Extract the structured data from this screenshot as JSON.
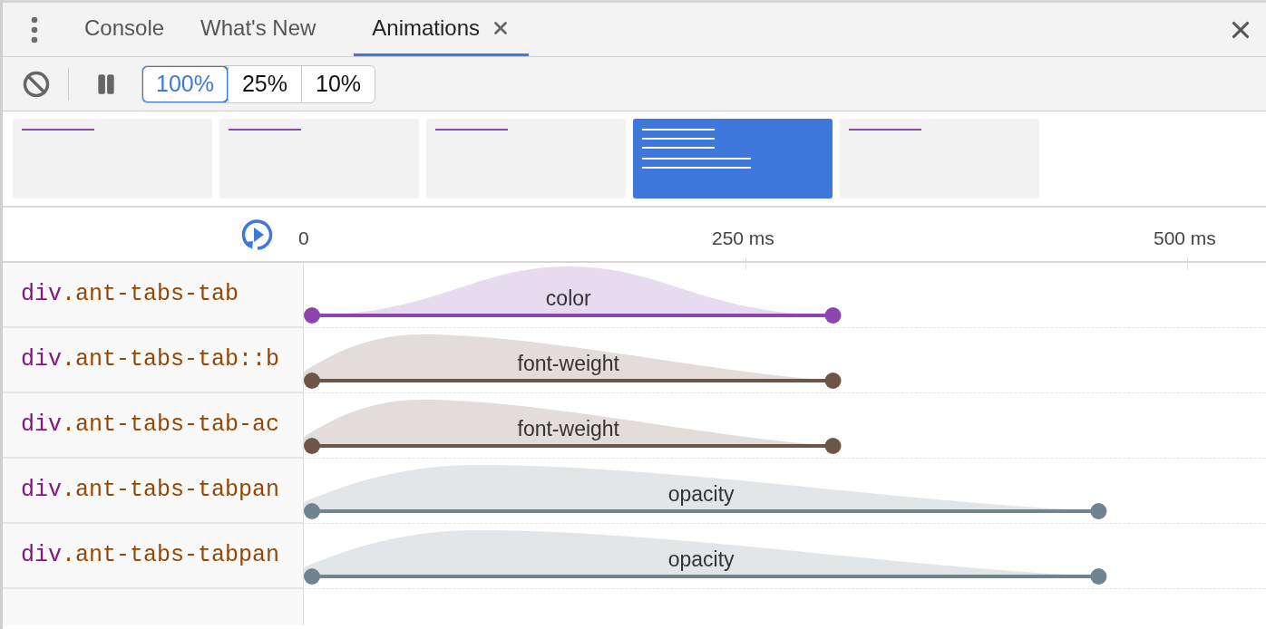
{
  "tabs": [
    {
      "label": "Console",
      "selected": false,
      "closable": false
    },
    {
      "label": "What's New",
      "selected": false,
      "closable": false
    },
    {
      "label": "Animations",
      "selected": true,
      "closable": true
    }
  ],
  "speeds": [
    {
      "label": "100%",
      "selected": true
    },
    {
      "label": "25%",
      "selected": false
    },
    {
      "label": "10%",
      "selected": false
    }
  ],
  "groups": [
    {
      "selected": false
    },
    {
      "selected": false
    },
    {
      "selected": false
    },
    {
      "selected": true
    },
    {
      "selected": false
    }
  ],
  "timeline": {
    "ticks": [
      "0",
      "250 ms",
      "500 ms"
    ]
  },
  "animations": [
    {
      "tag": "div",
      "selector": ".ant-tabs-tab",
      "property": "color",
      "color": "#8e44ad",
      "kind": "symmetric",
      "level": 0.55
    },
    {
      "tag": "div",
      "selector": ".ant-tabs-tab::b",
      "property": "font-weight",
      "color": "#6d5548",
      "kind": "skewed",
      "level": 0.55
    },
    {
      "tag": "div",
      "selector": ".ant-tabs-tab-ac",
      "property": "font-weight",
      "color": "#6d5548",
      "kind": "skewed",
      "level": 0.55
    },
    {
      "tag": "div",
      "selector": ".ant-tabs-tabpan",
      "property": "opacity",
      "color": "#6f8490",
      "kind": "skewed",
      "level": 0.826
    },
    {
      "tag": "div",
      "selector": ".ant-tabs-tabpan",
      "property": "opacity",
      "color": "#6f8490",
      "kind": "skewed",
      "level": 0.826
    }
  ]
}
